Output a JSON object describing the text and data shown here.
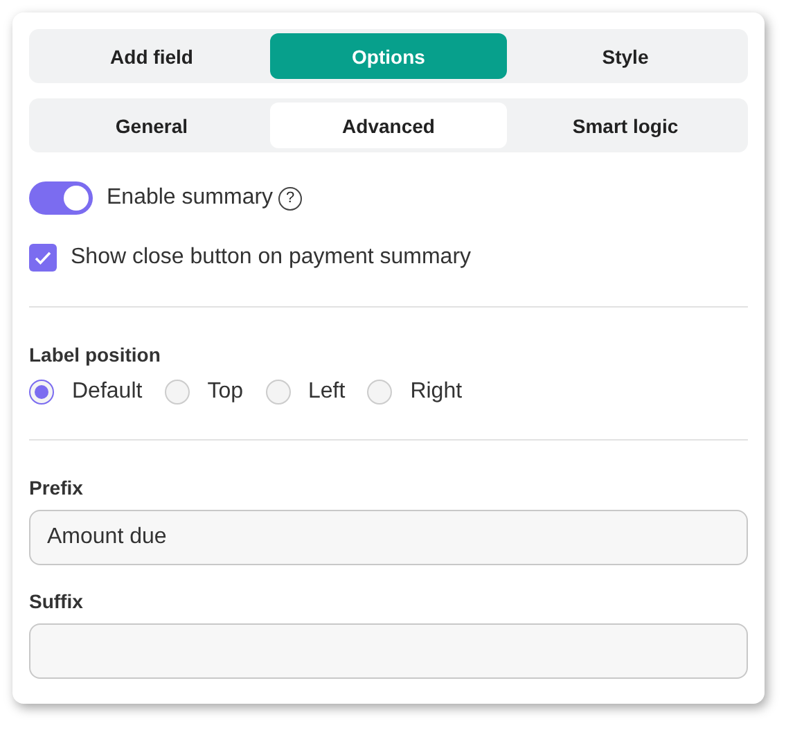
{
  "main_tabs": [
    {
      "label": "Add field",
      "selected": false
    },
    {
      "label": "Options",
      "selected": true
    },
    {
      "label": "Style",
      "selected": false
    }
  ],
  "sub_tabs": [
    {
      "label": "General",
      "selected": false
    },
    {
      "label": "Advanced",
      "selected": true
    },
    {
      "label": "Smart logic",
      "selected": false
    }
  ],
  "summary_toggle": {
    "label": "Enable summary",
    "on": true,
    "help": "?"
  },
  "close_button_checkbox": {
    "label": "Show close button on payment summary",
    "checked": true
  },
  "label_position": {
    "title": "Label position",
    "options": [
      {
        "label": "Default",
        "selected": true
      },
      {
        "label": "Top",
        "selected": false
      },
      {
        "label": "Left",
        "selected": false
      },
      {
        "label": "Right",
        "selected": false
      }
    ]
  },
  "prefix": {
    "label": "Prefix",
    "value": "Amount due"
  },
  "suffix": {
    "label": "Suffix"
  }
}
